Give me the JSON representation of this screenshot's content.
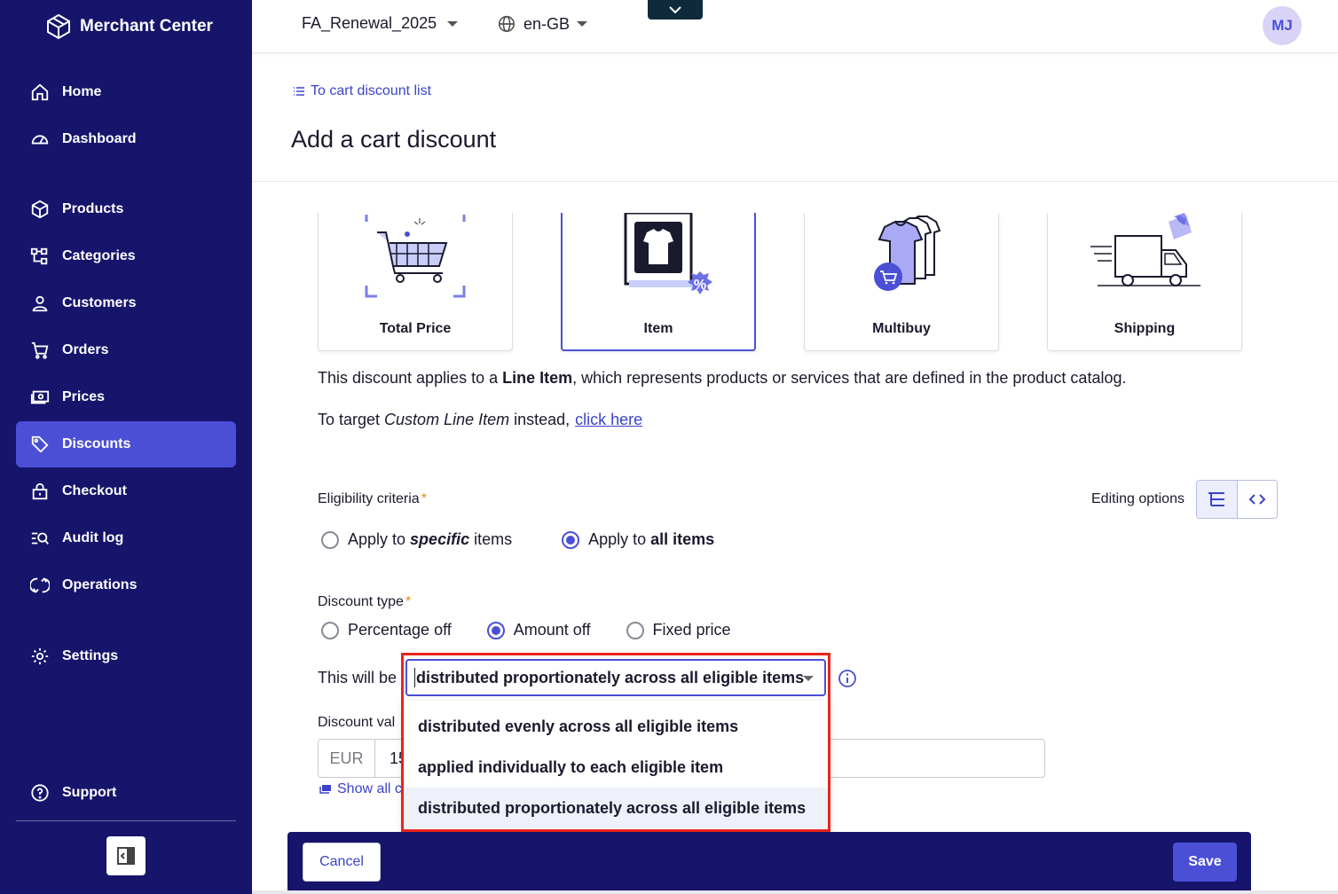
{
  "app": {
    "brand": "Merchant Center"
  },
  "sidebar": {
    "items": [
      {
        "label": "Home",
        "icon": "home-icon"
      },
      {
        "label": "Dashboard",
        "icon": "dashboard-icon"
      },
      {
        "label": "Products",
        "icon": "products-icon"
      },
      {
        "label": "Categories",
        "icon": "categories-icon"
      },
      {
        "label": "Customers",
        "icon": "customers-icon"
      },
      {
        "label": "Orders",
        "icon": "cart-icon"
      },
      {
        "label": "Prices",
        "icon": "prices-icon"
      },
      {
        "label": "Discounts",
        "icon": "tag-icon",
        "active": true
      },
      {
        "label": "Checkout",
        "icon": "lock-icon"
      },
      {
        "label": "Audit log",
        "icon": "audit-log-icon"
      },
      {
        "label": "Operations",
        "icon": "operations-icon"
      },
      {
        "label": "Settings",
        "icon": "gear-icon"
      }
    ],
    "support": "Support"
  },
  "topbar": {
    "project": "FA_Renewal_2025",
    "locale": "en-GB",
    "avatar_initials": "MJ"
  },
  "header": {
    "back_link": "To cart discount list",
    "title": "Add a cart discount"
  },
  "cards": [
    {
      "label": "Total Price",
      "selected": false
    },
    {
      "label": "Item",
      "selected": true
    },
    {
      "label": "Multibuy",
      "selected": false
    },
    {
      "label": "Shipping",
      "selected": false
    }
  ],
  "description": {
    "prefix": "This discount applies to a ",
    "bold": "Line Item",
    "suffix": ", which represents products or services that are defined in the product catalog.",
    "target_prefix": "To target ",
    "target_italic": "Custom Line Item",
    "target_suffix": " instead,",
    "target_link": "click here"
  },
  "eligibility": {
    "label": "Eligibility criteria",
    "required_mark": "*",
    "editing_options": "Editing options",
    "specific_prefix": "Apply to ",
    "specific_em": "specific",
    "specific_suffix": " items",
    "all_prefix": "Apply to ",
    "all_bold": "all items",
    "selected": "all"
  },
  "discount_type": {
    "label": "Discount type",
    "required_mark": "*",
    "options": [
      "Percentage off",
      "Amount off",
      "Fixed price"
    ],
    "selected": "Amount off"
  },
  "distribution": {
    "prefix": "This will be",
    "selected": "distributed proportionately across all eligible items",
    "options": [
      "distributed evenly across all eligible items",
      "applied individually to each eligible item",
      "distributed proportionately across all eligible items"
    ]
  },
  "discount_value": {
    "label": "Discount val",
    "currency": "EUR",
    "amount": "15",
    "show_all": "Show all c"
  },
  "footer": {
    "cancel": "Cancel",
    "save": "Save"
  },
  "colors": {
    "sidebar_bg": "#16146b",
    "accent": "#4b4fd6",
    "highlight_frame": "#e8251c"
  }
}
